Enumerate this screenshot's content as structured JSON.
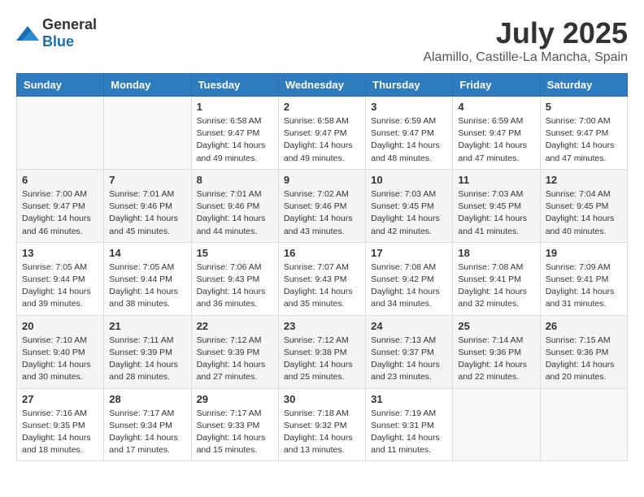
{
  "logo": {
    "text_general": "General",
    "text_blue": "Blue"
  },
  "title": "July 2025",
  "location": "Alamillo, Castille-La Mancha, Spain",
  "weekdays": [
    "Sunday",
    "Monday",
    "Tuesday",
    "Wednesday",
    "Thursday",
    "Friday",
    "Saturday"
  ],
  "weeks": [
    [
      {
        "day": "",
        "sunrise": "",
        "sunset": "",
        "daylight": ""
      },
      {
        "day": "",
        "sunrise": "",
        "sunset": "",
        "daylight": ""
      },
      {
        "day": "1",
        "sunrise": "Sunrise: 6:58 AM",
        "sunset": "Sunset: 9:47 PM",
        "daylight": "Daylight: 14 hours and 49 minutes."
      },
      {
        "day": "2",
        "sunrise": "Sunrise: 6:58 AM",
        "sunset": "Sunset: 9:47 PM",
        "daylight": "Daylight: 14 hours and 49 minutes."
      },
      {
        "day": "3",
        "sunrise": "Sunrise: 6:59 AM",
        "sunset": "Sunset: 9:47 PM",
        "daylight": "Daylight: 14 hours and 48 minutes."
      },
      {
        "day": "4",
        "sunrise": "Sunrise: 6:59 AM",
        "sunset": "Sunset: 9:47 PM",
        "daylight": "Daylight: 14 hours and 47 minutes."
      },
      {
        "day": "5",
        "sunrise": "Sunrise: 7:00 AM",
        "sunset": "Sunset: 9:47 PM",
        "daylight": "Daylight: 14 hours and 47 minutes."
      }
    ],
    [
      {
        "day": "6",
        "sunrise": "Sunrise: 7:00 AM",
        "sunset": "Sunset: 9:47 PM",
        "daylight": "Daylight: 14 hours and 46 minutes."
      },
      {
        "day": "7",
        "sunrise": "Sunrise: 7:01 AM",
        "sunset": "Sunset: 9:46 PM",
        "daylight": "Daylight: 14 hours and 45 minutes."
      },
      {
        "day": "8",
        "sunrise": "Sunrise: 7:01 AM",
        "sunset": "Sunset: 9:46 PM",
        "daylight": "Daylight: 14 hours and 44 minutes."
      },
      {
        "day": "9",
        "sunrise": "Sunrise: 7:02 AM",
        "sunset": "Sunset: 9:46 PM",
        "daylight": "Daylight: 14 hours and 43 minutes."
      },
      {
        "day": "10",
        "sunrise": "Sunrise: 7:03 AM",
        "sunset": "Sunset: 9:45 PM",
        "daylight": "Daylight: 14 hours and 42 minutes."
      },
      {
        "day": "11",
        "sunrise": "Sunrise: 7:03 AM",
        "sunset": "Sunset: 9:45 PM",
        "daylight": "Daylight: 14 hours and 41 minutes."
      },
      {
        "day": "12",
        "sunrise": "Sunrise: 7:04 AM",
        "sunset": "Sunset: 9:45 PM",
        "daylight": "Daylight: 14 hours and 40 minutes."
      }
    ],
    [
      {
        "day": "13",
        "sunrise": "Sunrise: 7:05 AM",
        "sunset": "Sunset: 9:44 PM",
        "daylight": "Daylight: 14 hours and 39 minutes."
      },
      {
        "day": "14",
        "sunrise": "Sunrise: 7:05 AM",
        "sunset": "Sunset: 9:44 PM",
        "daylight": "Daylight: 14 hours and 38 minutes."
      },
      {
        "day": "15",
        "sunrise": "Sunrise: 7:06 AM",
        "sunset": "Sunset: 9:43 PM",
        "daylight": "Daylight: 14 hours and 36 minutes."
      },
      {
        "day": "16",
        "sunrise": "Sunrise: 7:07 AM",
        "sunset": "Sunset: 9:43 PM",
        "daylight": "Daylight: 14 hours and 35 minutes."
      },
      {
        "day": "17",
        "sunrise": "Sunrise: 7:08 AM",
        "sunset": "Sunset: 9:42 PM",
        "daylight": "Daylight: 14 hours and 34 minutes."
      },
      {
        "day": "18",
        "sunrise": "Sunrise: 7:08 AM",
        "sunset": "Sunset: 9:41 PM",
        "daylight": "Daylight: 14 hours and 32 minutes."
      },
      {
        "day": "19",
        "sunrise": "Sunrise: 7:09 AM",
        "sunset": "Sunset: 9:41 PM",
        "daylight": "Daylight: 14 hours and 31 minutes."
      }
    ],
    [
      {
        "day": "20",
        "sunrise": "Sunrise: 7:10 AM",
        "sunset": "Sunset: 9:40 PM",
        "daylight": "Daylight: 14 hours and 30 minutes."
      },
      {
        "day": "21",
        "sunrise": "Sunrise: 7:11 AM",
        "sunset": "Sunset: 9:39 PM",
        "daylight": "Daylight: 14 hours and 28 minutes."
      },
      {
        "day": "22",
        "sunrise": "Sunrise: 7:12 AM",
        "sunset": "Sunset: 9:39 PM",
        "daylight": "Daylight: 14 hours and 27 minutes."
      },
      {
        "day": "23",
        "sunrise": "Sunrise: 7:12 AM",
        "sunset": "Sunset: 9:38 PM",
        "daylight": "Daylight: 14 hours and 25 minutes."
      },
      {
        "day": "24",
        "sunrise": "Sunrise: 7:13 AM",
        "sunset": "Sunset: 9:37 PM",
        "daylight": "Daylight: 14 hours and 23 minutes."
      },
      {
        "day": "25",
        "sunrise": "Sunrise: 7:14 AM",
        "sunset": "Sunset: 9:36 PM",
        "daylight": "Daylight: 14 hours and 22 minutes."
      },
      {
        "day": "26",
        "sunrise": "Sunrise: 7:15 AM",
        "sunset": "Sunset: 9:36 PM",
        "daylight": "Daylight: 14 hours and 20 minutes."
      }
    ],
    [
      {
        "day": "27",
        "sunrise": "Sunrise: 7:16 AM",
        "sunset": "Sunset: 9:35 PM",
        "daylight": "Daylight: 14 hours and 18 minutes."
      },
      {
        "day": "28",
        "sunrise": "Sunrise: 7:17 AM",
        "sunset": "Sunset: 9:34 PM",
        "daylight": "Daylight: 14 hours and 17 minutes."
      },
      {
        "day": "29",
        "sunrise": "Sunrise: 7:17 AM",
        "sunset": "Sunset: 9:33 PM",
        "daylight": "Daylight: 14 hours and 15 minutes."
      },
      {
        "day": "30",
        "sunrise": "Sunrise: 7:18 AM",
        "sunset": "Sunset: 9:32 PM",
        "daylight": "Daylight: 14 hours and 13 minutes."
      },
      {
        "day": "31",
        "sunrise": "Sunrise: 7:19 AM",
        "sunset": "Sunset: 9:31 PM",
        "daylight": "Daylight: 14 hours and 11 minutes."
      },
      {
        "day": "",
        "sunrise": "",
        "sunset": "",
        "daylight": ""
      },
      {
        "day": "",
        "sunrise": "",
        "sunset": "",
        "daylight": ""
      }
    ]
  ]
}
